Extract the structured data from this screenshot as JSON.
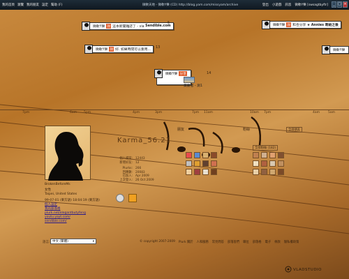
{
  "topbar": {
    "nav": [
      "我的首頁",
      "瀏覽",
      "我的朋友",
      "設定",
      "幫助 (F)"
    ],
    "title": "微軟天地 - 微軟Y樂 (CD) http://blog.yam.com/missyam/archive",
    "right": [
      "登出",
      "小遊戲",
      "訊息",
      "微軟Y樂 [swsagtbyftr]"
    ]
  },
  "bubbles": [
    {
      "name": "微軟Y樂",
      "text": "這本新聞雜誌了 - via",
      "source": "Sendible.com",
      "num": "5"
    },
    {
      "name": "微軟Y樂",
      "text": "和合分享 ★",
      "source": "Annies 寄給之後",
      "num": ""
    },
    {
      "name": "微軟Y樂",
      "text": "好. 如果時間可以重用...",
      "source": "",
      "num": "13"
    },
    {
      "name": "微軟Y樂",
      "text": "",
      "source": "",
      "num": ""
    },
    {
      "name": "微軟Y樂",
      "text": "",
      "source": "美麗者 - 測1",
      "num": "14"
    }
  ],
  "timeline": [
    "7pm",
    "6am",
    "5pm",
    "4pm",
    "3pm",
    "7pm",
    "11am",
    "10am",
    "7pm",
    "4am",
    "5am"
  ],
  "profile": {
    "display_name": "Karma_56.21",
    "username": "BrokenBeforeMs",
    "gender": "女性",
    "location": "Taipei, United States",
    "dob_line": "99-07-01 (東方語)  18:04:19 (東方語)",
    "links": [
      "個人設定",
      "我的部落格",
      "plurk.net/elegantbutyfeng",
      "youtu.yayt.com/",
      "sendible.com/"
    ]
  },
  "stats": [
    {
      "k": "個人檔案:",
      "v": "12443"
    },
    {
      "k": "新增好友:",
      "v": "12"
    },
    {
      "k": "Plurks:",
      "v": "266"
    },
    {
      "k": "回應數:",
      "v": "20083"
    },
    {
      "k": "已加入:",
      "v": "Apr 2009"
    },
    {
      "k": "上次登入:",
      "v": "26 Oct 2009"
    }
  ],
  "sections": {
    "friends": "朋友",
    "fans": "粉絲",
    "more_friends": "全部朋友",
    "more_fans": "全部粉絲 (182)"
  },
  "footer": {
    "lang_label": "語言:",
    "lang_value": "中文 (繁體)",
    "links": [
      "© copyright 2007-2009",
      "Plurk 關於",
      "人和服務",
      "常見問答",
      "部落客們",
      "職位",
      "部落格",
      "電子",
      "條款",
      "隱私權政策"
    ],
    "brand": "VLADSTUDIO"
  },
  "colors": {
    "accent": "#e05c2b",
    "bg": "#b77428"
  }
}
